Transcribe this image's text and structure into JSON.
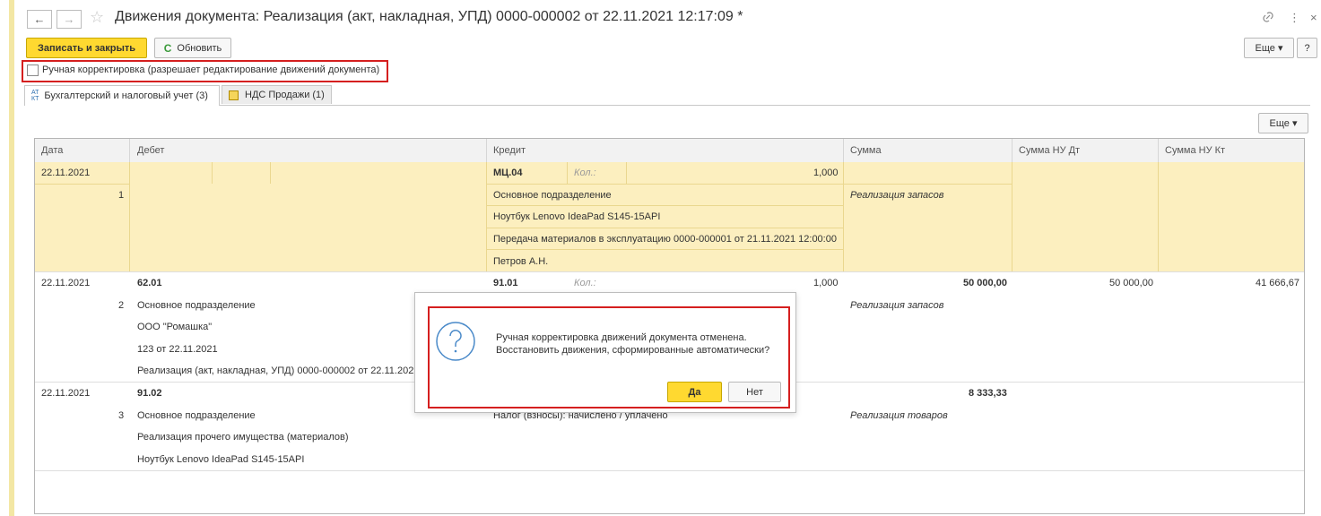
{
  "window": {
    "title": "Движения документа: Реализация (акт, накладная, УПД) 0000-000002 от 22.11.2021 12:17:09 *",
    "back_icon": "←",
    "forward_icon": "→",
    "star_icon": "☆",
    "link_icon": "🔗",
    "menu_icon": "⋮",
    "close_icon": "×"
  },
  "toolbar": {
    "save_close_label": "Записать и закрыть",
    "refresh_label": "Обновить",
    "refresh_icon": "C",
    "more_label": "Еще ▾",
    "help_label": "?"
  },
  "manual_correction": {
    "label": "Ручная корректировка (разрешает редактирование движений документа)"
  },
  "tabs": [
    {
      "label": "Бухгалтерский и налоговый учет (3)",
      "icon": "АТ КТ"
    },
    {
      "label": "НДС Продажи (1)",
      "icon": "▣"
    }
  ],
  "table_toolbar": {
    "more_label": "Еще ▾"
  },
  "table": {
    "columns": [
      "Дата",
      "Дебет",
      "Кредит",
      "Сумма",
      "Сумма НУ Дт",
      "Сумма НУ Кт"
    ],
    "rows": [
      {
        "date": "22.11.2021",
        "num": "1",
        "debit": [],
        "credit_account": "МЦ.04",
        "credit_qty_label": "Кол.:",
        "credit_qty": "1,000",
        "credit_lines": [
          "Основное подразделение",
          "Ноутбук Lenovo IdeaPad S145-15API",
          "Передача материалов в эксплуатацию 0000-000001 от 21.11.2021 12:00:00",
          "Петров А.Н."
        ],
        "sum": "",
        "sum_note": "Реализация запасов",
        "nu_dt": "",
        "nu_kt": ""
      },
      {
        "date": "22.11.2021",
        "num": "2",
        "debit_account": "62.01",
        "debit": [
          "Основное подразделение",
          "ООО \"Ромашка\"",
          "123 от 22.11.2021",
          "Реализация (акт, накладная, УПД) 0000-000002 от 22.11.2021"
        ],
        "credit_account": "91.01",
        "credit_qty_label": "Кол.:",
        "credit_qty": "1,000",
        "credit_lines": [],
        "sum": "50 000,00",
        "sum_note": "Реализация запасов",
        "nu_dt": "50 000,00",
        "nu_kt": "41 666,67"
      },
      {
        "date": "22.11.2021",
        "num": "3",
        "debit_account": "91.02",
        "debit": [
          "Основное подразделение",
          "Реализация прочего имущества (материалов)",
          "Ноутбук Lenovo IdeaPad S145-15API"
        ],
        "credit_account": "",
        "credit_lines": [
          "Налог (взносы): начислено / уплачено"
        ],
        "sum": "8 333,33",
        "sum_note": "Реализация товаров",
        "nu_dt": "",
        "nu_kt": ""
      }
    ]
  },
  "dialog": {
    "line1": "Ручная корректировка движений документа отменена.",
    "line2": "Восстановить движения, сформированные автоматически?",
    "yes_label": "Да",
    "no_label": "Нет"
  },
  "colors": {
    "accent_yellow": "#ffd930",
    "highlight_red": "#d51f1f",
    "selected_row": "#fcefbf",
    "icon_blue": "#4a8ac9"
  }
}
